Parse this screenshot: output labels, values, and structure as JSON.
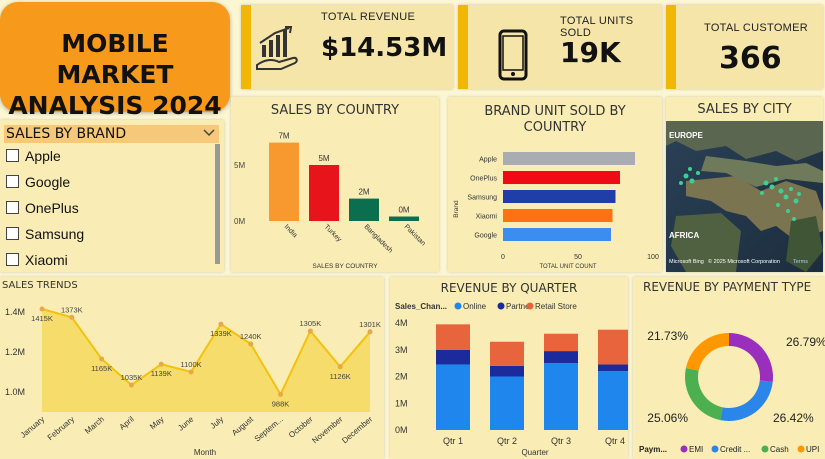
{
  "title": "MOBILE MARKET\nANALYSIS 2024",
  "kpis": {
    "revenue": {
      "label": "TOTAL REVENUE",
      "value": "$14.53M",
      "icon": "revenue-growth-icon"
    },
    "units": {
      "label": "TOTAL UNITS SOLD",
      "value": "19K",
      "icon": "smartphone-icon"
    },
    "customers": {
      "label": "TOTAL CUSTOMER",
      "value": "366"
    }
  },
  "slicer": {
    "title": "SALES BY BRAND",
    "options": [
      "Apple",
      "Google",
      "OnePlus",
      "Samsung",
      "Xiaomi"
    ]
  },
  "map": {
    "title": "SALES BY CITY",
    "labels": [
      "EUROPE",
      "AFRICA"
    ],
    "attribution": "Microsoft Bing",
    "copyright": "© 2025 Microsoft Corporation",
    "terms": "Terms"
  },
  "colors": {
    "accent": "#f2b705",
    "title_bg": "#f79a1b",
    "panel_bg": "#f9edb5"
  },
  "chart_data": [
    {
      "id": "sales_by_country",
      "type": "bar",
      "title": "SALES BY COUNTRY",
      "xlabel": "SALES BY COUNTRY",
      "categories": [
        "India",
        "Turkey",
        "Bangladesh",
        "Pakistan"
      ],
      "values": [
        7000000,
        5000000,
        2000000,
        400000
      ],
      "data_labels": [
        "7M",
        "5M",
        "2M",
        "0M"
      ],
      "colors": [
        "#f7992e",
        "#e8141c",
        "#0b6e4f",
        "#0b6e4f"
      ],
      "yticks": [
        "0M",
        "5M"
      ],
      "ylim": [
        0,
        7500000
      ],
      "grid": false
    },
    {
      "id": "brand_units",
      "type": "bar",
      "orientation": "horizontal",
      "title": "BRAND UNIT SOLD BY COUNTRY",
      "xlabel": "TOTAL UNIT COUNT",
      "ylabel": "Brand",
      "categories": [
        "Apple",
        "OnePlus",
        "Samsung",
        "Xiaomi",
        "Google"
      ],
      "values": [
        88,
        78,
        75,
        73,
        72
      ],
      "colors": [
        "#a9adb2",
        "#ef0a16",
        "#1f3ea8",
        "#ff7112",
        "#3b8ef0"
      ],
      "xticks": [
        "0",
        "50",
        "100"
      ],
      "xlim": [
        0,
        100
      ]
    },
    {
      "id": "sales_trends",
      "type": "area",
      "title": "SALES TRENDS",
      "xlabel": "Month",
      "categories": [
        "January",
        "February",
        "March",
        "April",
        "May",
        "June",
        "July",
        "August",
        "Septem...",
        "October",
        "November",
        "December"
      ],
      "values": [
        1415,
        1373,
        1165,
        1035,
        1139,
        1100,
        1339,
        1240,
        988,
        1305,
        1126,
        1301
      ],
      "data_labels": [
        "1415K",
        "1373K",
        "1165K",
        "1035K",
        "1139K",
        "1100K",
        "1339K",
        "1240K",
        "988K",
        "1305K",
        "1126K",
        "1301K"
      ],
      "yticks": [
        "1.0M",
        "1.2M",
        "1.4M"
      ],
      "ylim": [
        900,
        1450
      ],
      "color": "#f5d64c"
    },
    {
      "id": "revenue_by_quarter",
      "type": "bar",
      "stacked": true,
      "title": "REVENUE BY QUARTER",
      "xlabel": "Quarter",
      "legend_title": "Sales_Chan...",
      "categories": [
        "Qtr 1",
        "Qtr 2",
        "Qtr 3",
        "Qtr 4"
      ],
      "series": [
        {
          "name": "Online",
          "color": "#1f86ee",
          "values": [
            2.45,
            2.0,
            2.5,
            2.2
          ]
        },
        {
          "name": "Partner",
          "color": "#1b2b9b",
          "values": [
            0.55,
            0.4,
            0.45,
            0.25
          ]
        },
        {
          "name": "Retail Store",
          "color": "#e8643c",
          "values": [
            0.95,
            0.9,
            0.65,
            1.3
          ]
        }
      ],
      "yticks": [
        "0M",
        "1M",
        "2M",
        "3M",
        "4M"
      ],
      "ylim": [
        0,
        4
      ]
    },
    {
      "id": "revenue_by_payment",
      "type": "pie",
      "donut": true,
      "title": "REVENUE BY PAYMENT TYPE",
      "legend_title": "Paym...",
      "labels": [
        "EMI",
        "Credit ...",
        "Cash",
        "UPI"
      ],
      "values": [
        26.79,
        26.42,
        25.06,
        21.73
      ],
      "data_labels": [
        "26.79%",
        "26.42%",
        "25.06%",
        "21.73%"
      ],
      "colors": [
        "#9b2fbd",
        "#2a86e8",
        "#4caf50",
        "#ff9800"
      ]
    }
  ]
}
